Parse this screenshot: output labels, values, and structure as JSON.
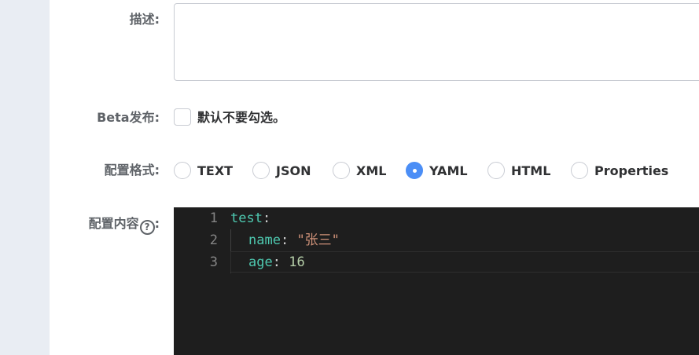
{
  "form": {
    "description_label": "描述:",
    "beta_label": "Beta发布:",
    "beta_checkbox_text": "默认不要勾选。",
    "format_label": "配置格式:",
    "content_label": "配置内容",
    "content_label_suffix": ":",
    "help_icon_glyph": "?"
  },
  "formats": {
    "selected": "YAML",
    "options": [
      "TEXT",
      "JSON",
      "XML",
      "YAML",
      "HTML",
      "Properties"
    ]
  },
  "editor": {
    "line_numbers": [
      "1",
      "2",
      "3"
    ],
    "lines": [
      {
        "key": "test",
        "colon": ":",
        "value": ""
      },
      {
        "key": "name",
        "colon": ": ",
        "value": "\"张三\""
      },
      {
        "key": "age",
        "colon": ": ",
        "value": "16"
      }
    ]
  },
  "colors": {
    "accent": "#4b8ef6",
    "editor_bg": "#1e1e1e",
    "yaml_key": "#4ec9b0",
    "yaml_string": "#ce9178",
    "yaml_number": "#b5cea8"
  }
}
